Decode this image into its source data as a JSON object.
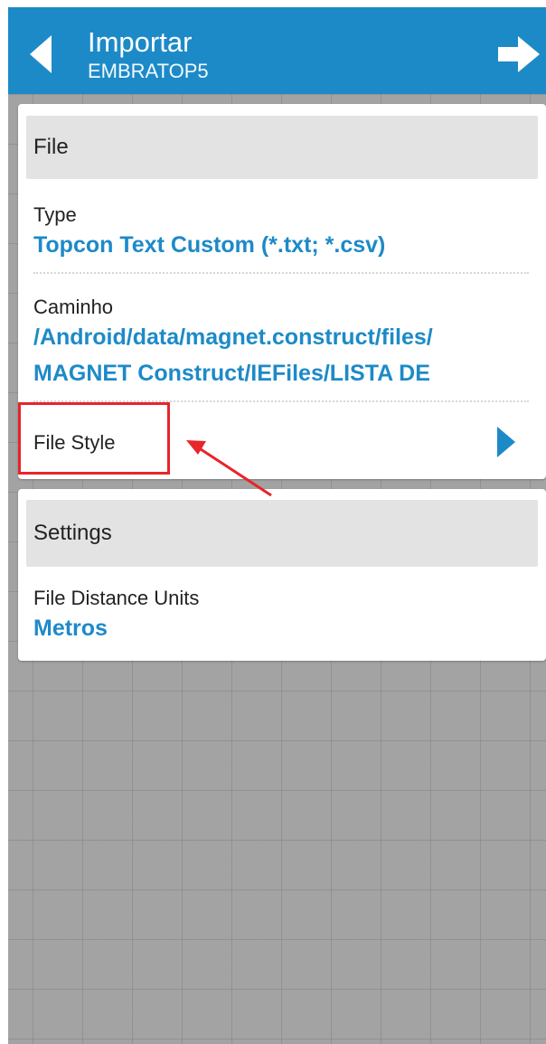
{
  "app_bar": {
    "title": "Importar",
    "subtitle": "EMBRATOP5",
    "back_icon": "triangle-left-icon",
    "forward_icon": "arrow-right-icon",
    "color": "#1d8ac8"
  },
  "file_section": {
    "header": "File",
    "type_label": "Type",
    "type_value": "Topcon Text Custom (*.txt; *.csv)",
    "path_label": "Caminho",
    "path_value_line1": "/Android/data/magnet.construct/files/",
    "path_value_line2": "MAGNET Construct/IEFiles/LISTA DE",
    "file_style_label": "File Style",
    "file_style_icon": "chevron-right-icon"
  },
  "settings_section": {
    "header": "Settings",
    "distance_units_label": "File Distance Units",
    "distance_units_value": "Metros"
  },
  "annotation": {
    "color": "#e8252a",
    "target": "File Style"
  },
  "colors": {
    "accent": "#1d8ac8",
    "background": "#a3a3a3",
    "section_header": "#e3e3e3"
  }
}
